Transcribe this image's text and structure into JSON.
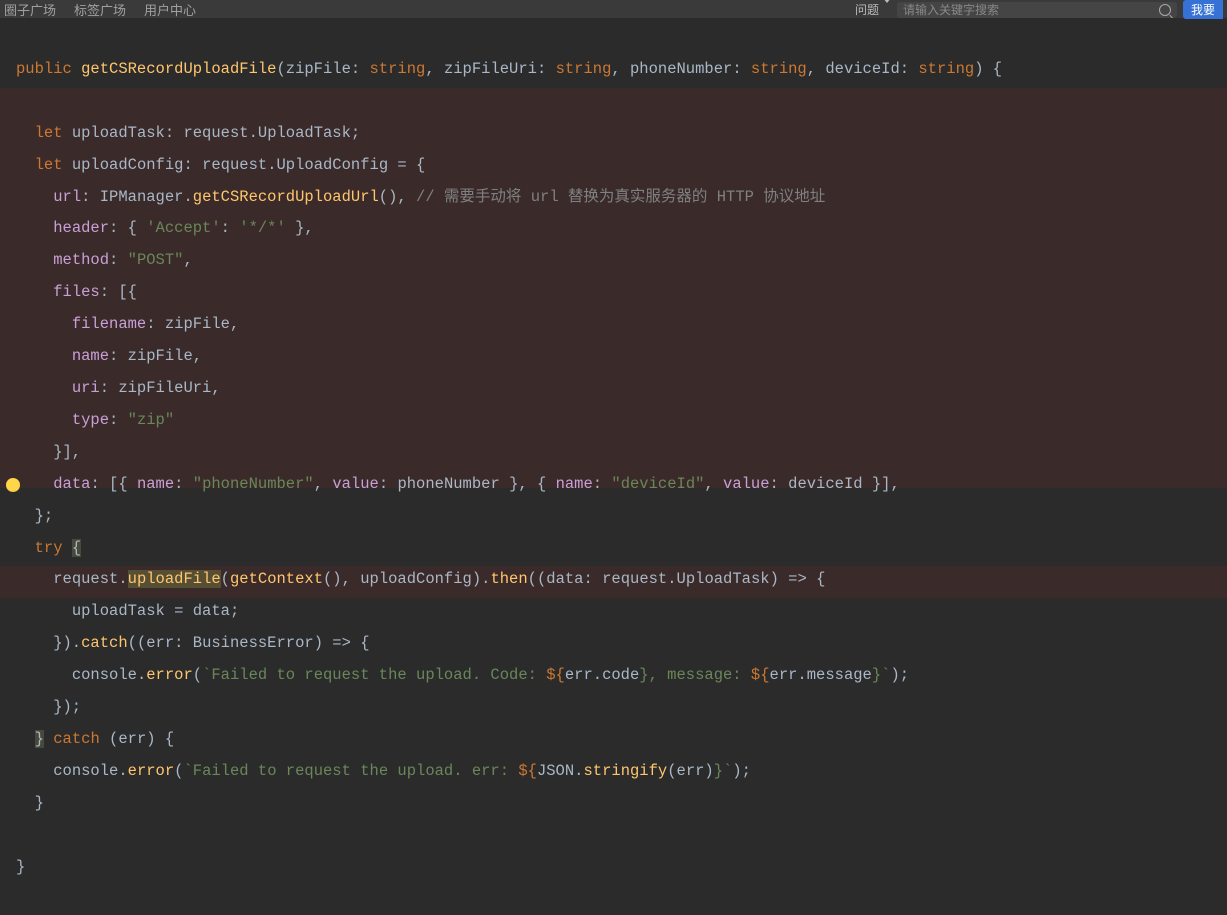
{
  "nav": {
    "circle": "圈子广场",
    "tags": "标签广场",
    "user": "用户中心"
  },
  "search": {
    "filter": "问题",
    "placeholder": "请输入关键字搜索"
  },
  "actionBtn": "我要",
  "code": {
    "l1": {
      "public": "public",
      "fn": "getCSRecordUploadFile",
      "p1": "zipFile",
      "t1": "string",
      "p2": "zipFileUri",
      "t2": "string",
      "p3": "phoneNumber",
      "t3": "string",
      "p4": "deviceId",
      "t4": "string"
    },
    "l3": {
      "let": "let",
      "v": "uploadTask",
      "req": "request",
      "cls": "UploadTask"
    },
    "l4": {
      "let": "let",
      "v": "uploadConfig",
      "req": "request",
      "cls": "UploadConfig"
    },
    "l5": {
      "k": "url",
      "obj": "IPManager",
      "m": "getCSRecordUploadUrl",
      "cmt": "// 需要手动将 url 替换为真实服务器的 HTTP 协议地址"
    },
    "l6": {
      "k": "header",
      "ak": "'Accept'",
      "av": "'*/*'"
    },
    "l7": {
      "k": "method",
      "v": "\"POST\""
    },
    "l8": {
      "k": "files"
    },
    "l9": {
      "k": "filename",
      "v": "zipFile"
    },
    "l10": {
      "k": "name",
      "v": "zipFile"
    },
    "l11": {
      "k": "uri",
      "v": "zipFileUri"
    },
    "l12": {
      "k": "type",
      "v": "\"zip\""
    },
    "l14": {
      "k": "data",
      "n1": "name",
      "s1": "\"phoneNumber\"",
      "v1k": "value",
      "v1": "phoneNumber",
      "n2": "name",
      "s2": "\"deviceId\"",
      "v2k": "value",
      "v2": "deviceId"
    },
    "l16": {
      "try": "try"
    },
    "l17": {
      "req": "request",
      "m": "uploadFile",
      "gc": "getContext",
      "cfg": "uploadConfig",
      "then": "then",
      "d": "data",
      "rt": "request",
      "cls": "UploadTask"
    },
    "l18": {
      "a": "uploadTask",
      "b": "data"
    },
    "l19": {
      "catch": "catch",
      "err": "err",
      "t": "BusinessError"
    },
    "l20": {
      "c": "console",
      "e": "error",
      "s1": "`Failed to request the upload. Code: ",
      "px": "${",
      "o1": "err",
      "p1": "code",
      "mid": "}, message: ",
      "o2": "err",
      "p2": "message",
      "end": "}`"
    },
    "l22": {
      "catch": "catch",
      "err": "err"
    },
    "l23": {
      "c": "console",
      "e": "error",
      "s1": "`Failed to request the upload. err: ",
      "px": "${",
      "j": "JSON",
      "m": "stringify",
      "a": "err",
      "end": "}`"
    }
  }
}
